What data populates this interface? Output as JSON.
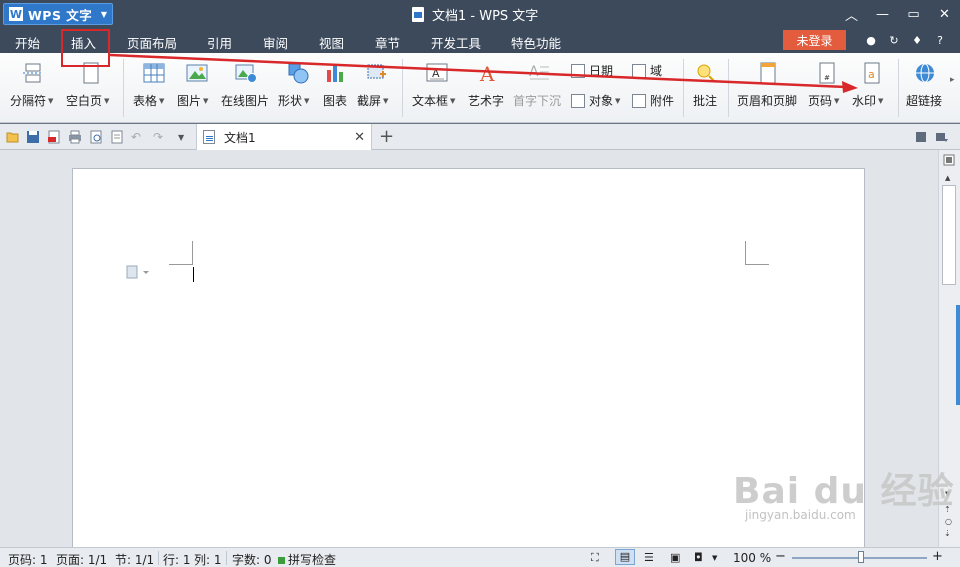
{
  "title_bar": {
    "app_menu": "WPS 文字",
    "window_title": "文档1 - WPS 文字"
  },
  "ribbon_tabs": {
    "items": [
      "开始",
      "插入",
      "页面布局",
      "引用",
      "审阅",
      "视图",
      "章节",
      "开发工具",
      "特色功能"
    ],
    "active": "插入",
    "login": "未登录"
  },
  "ribbon": {
    "page_break": "分隔符",
    "blank_page": "空白页",
    "table": "表格",
    "picture": "图片",
    "online_picture": "在线图片",
    "shape": "形状",
    "chart": "图表",
    "screenshot": "截屏",
    "text_box": "文本框",
    "word_art": "艺术字",
    "drop_cap": "首字下沉",
    "date": "日期",
    "field": "域",
    "object": "对象",
    "attachment": "附件",
    "comment": "批注",
    "header_footer": "页眉和页脚",
    "page_number": "页码",
    "watermark": "水印",
    "hyperlink": "超链接"
  },
  "document_tab": {
    "name": "文档1"
  },
  "watermark_overlay": {
    "brand": "Bai du 经验",
    "url": "jingyan.baidu.com"
  },
  "status_bar": {
    "page_num": "页码: 1",
    "pages": "页面: 1/1",
    "section": "节: 1/1",
    "row": "行: 1",
    "col": "列: 1",
    "word_count": "字数: 0",
    "spell_check": "拼写检查",
    "zoom": "100 %"
  },
  "colors": {
    "title_bg": "#3c4a5c",
    "accent": "#2f78c9",
    "login_bg": "#e25c3d",
    "annotation_red": "#d9282a"
  }
}
